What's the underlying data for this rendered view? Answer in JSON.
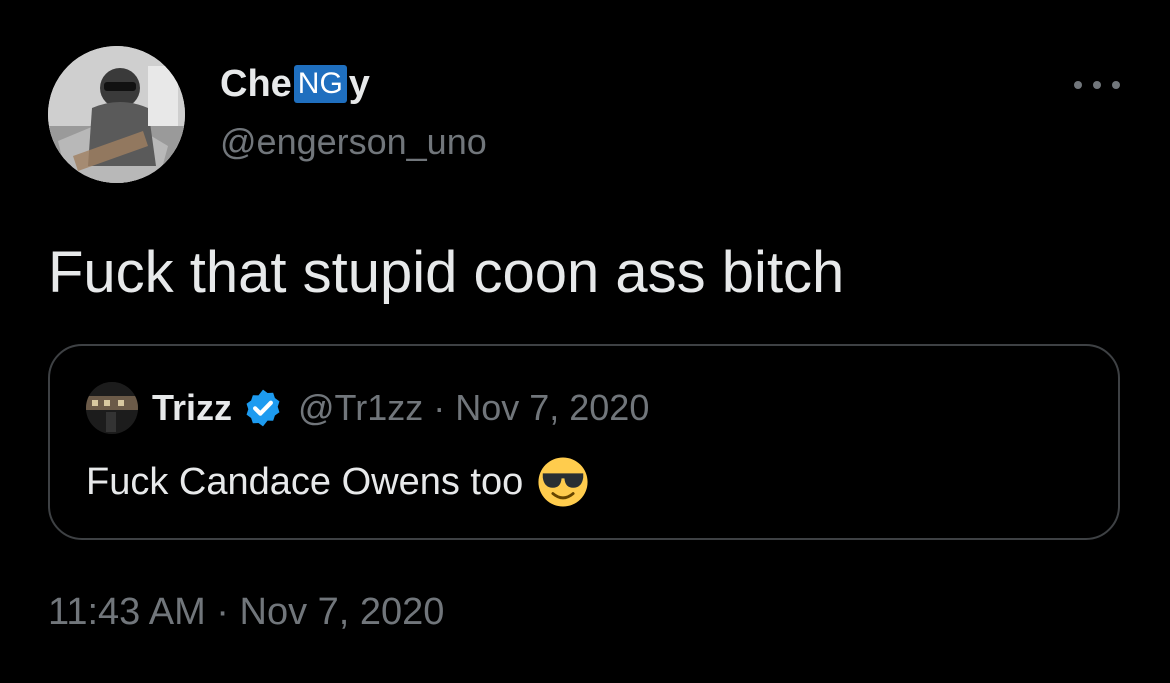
{
  "author": {
    "name_before": "Che",
    "name_badge": "NG",
    "name_after": "y",
    "handle": "@engerson_uno"
  },
  "tweet": {
    "text": "Fuck that stupid coon ass bitch",
    "timestamp": "11:43 AM · Nov 7, 2020"
  },
  "quoted_tweet": {
    "name": "Trizz",
    "handle_date": "@Tr1zz · Nov 7, 2020",
    "text": "Fuck Candace Owens too",
    "verified": true,
    "emoji": "smiling-face-with-sunglasses"
  },
  "icons": {
    "more": "more-icon",
    "verified": "verified-badge-icon"
  },
  "colors": {
    "background": "#000000",
    "primary_text": "#e7e9ea",
    "secondary_text": "#71767b",
    "verified_blue": "#1d9bf0",
    "card_border": "#3e4144"
  }
}
